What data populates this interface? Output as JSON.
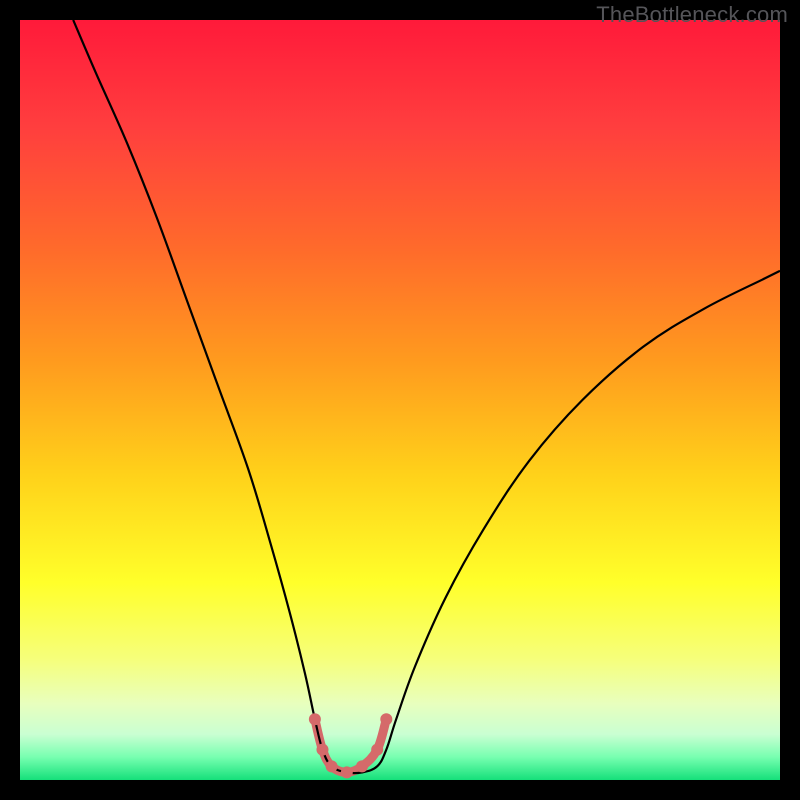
{
  "watermark": "TheBottleneck.com",
  "chart_data": {
    "type": "line",
    "title": "",
    "xlabel": "",
    "ylabel": "",
    "xlim": [
      0,
      100
    ],
    "ylim": [
      0,
      100
    ],
    "grid": false,
    "legend": false,
    "background": {
      "type": "vertical_gradient",
      "stops": [
        {
          "pos": 0.0,
          "color": "#ff1a3a"
        },
        {
          "pos": 0.14,
          "color": "#ff3e3e"
        },
        {
          "pos": 0.3,
          "color": "#ff6a2b"
        },
        {
          "pos": 0.45,
          "color": "#ff9b1e"
        },
        {
          "pos": 0.6,
          "color": "#ffd21a"
        },
        {
          "pos": 0.74,
          "color": "#ffff2a"
        },
        {
          "pos": 0.84,
          "color": "#f6ff7a"
        },
        {
          "pos": 0.9,
          "color": "#e8ffbe"
        },
        {
          "pos": 0.94,
          "color": "#c9ffd2"
        },
        {
          "pos": 0.97,
          "color": "#77ffb0"
        },
        {
          "pos": 1.0,
          "color": "#15e07a"
        }
      ]
    },
    "series": [
      {
        "name": "bottleneck-curve",
        "stroke": "#000000",
        "stroke_width": 2.2,
        "x": [
          7,
          10,
          14,
          18,
          22,
          26,
          30,
          33,
          35.5,
          37.5,
          38.8,
          39.8,
          41.0,
          43.0,
          45.0,
          47.0,
          48.2,
          49.5,
          52,
          56,
          61,
          67,
          74,
          82,
          90,
          98,
          100
        ],
        "y": [
          100,
          93,
          84,
          74,
          63,
          52,
          41,
          31,
          22,
          14,
          8,
          4,
          1.8,
          1.0,
          1.0,
          1.8,
          4,
          8,
          15,
          24,
          33,
          42,
          50,
          57,
          62,
          66,
          67
        ]
      },
      {
        "name": "tolerance-band",
        "stroke": "#d56a6a",
        "stroke_width": 9,
        "linecap": "round",
        "x": [
          38.8,
          39.8,
          41.0,
          43.0,
          45.0,
          47.0,
          48.2
        ],
        "y": [
          8,
          4,
          1.8,
          1.0,
          1.8,
          4,
          8
        ]
      }
    ],
    "markers": {
      "color": "#d56a6a",
      "radius": 6,
      "points": [
        {
          "x": 38.8,
          "y": 8
        },
        {
          "x": 39.8,
          "y": 4
        },
        {
          "x": 41.0,
          "y": 1.8
        },
        {
          "x": 43.0,
          "y": 1.0
        },
        {
          "x": 45.0,
          "y": 1.8
        },
        {
          "x": 47.0,
          "y": 4
        },
        {
          "x": 48.2,
          "y": 8
        }
      ]
    }
  }
}
